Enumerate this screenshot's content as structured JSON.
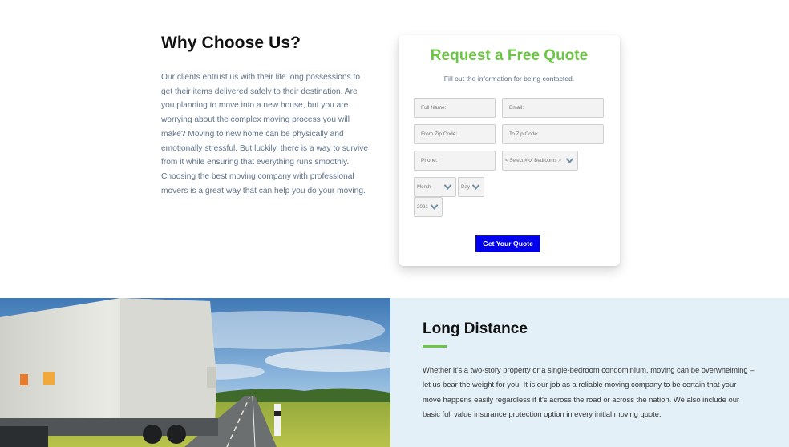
{
  "why": {
    "title": "Why Choose Us?",
    "body": "Our clients entrust us with their life long possessions to get their items delivered safely to their destination. Are you planning to move into a new house, but you are worrying about the complex moving process you will make? Moving to new home can be physically and emotionally stressful. But luckily, there is a way to survive from it while ensuring that everything runs smoothly. Choosing the best moving company with professional movers is a great way that can help you do your moving."
  },
  "quote": {
    "title": "Request a Free Quote",
    "subtitle": "Fill out the information for being contacted.",
    "fields": {
      "full_name": {
        "placeholder": "Full Name:",
        "value": ""
      },
      "email": {
        "placeholder": "Email:",
        "value": ""
      },
      "from_zip": {
        "placeholder": "From Zip Code:",
        "value": ""
      },
      "to_zip": {
        "placeholder": "To Zip Code:",
        "value": ""
      },
      "phone": {
        "placeholder": "Phone:",
        "value": ""
      }
    },
    "bedrooms_selected": "< Select # of Bedrooms >",
    "month_selected": "Month",
    "day_selected": "Day",
    "year_selected": "2021",
    "submit_label": "Get Your Quote"
  },
  "long_distance": {
    "title": "Long Distance",
    "body": "Whether it's a two-story property or a single-bedroom condominium, moving can be overwhelming – let us bear the weight for you. It is our job as a reliable moving company to be certain that your move happens easily regardless if it's across the road or across the nation. We also include our basic full value insurance protection option in every initial moving quote."
  },
  "colors": {
    "accent_green": "#6cc644",
    "button_blue": "#0000ee",
    "panel_blue": "#e3f0f8",
    "body_text": "#5f7389"
  },
  "icons": [
    "chevron-down-icon"
  ]
}
